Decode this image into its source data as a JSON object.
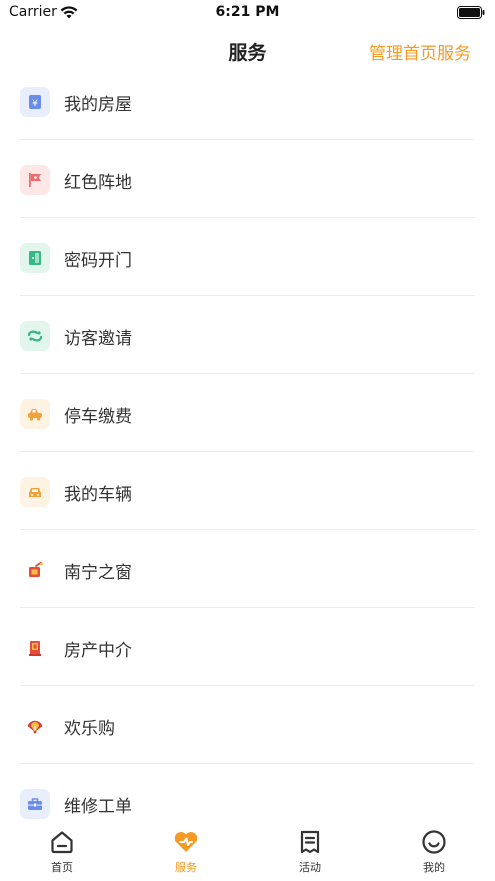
{
  "status_bar": {
    "carrier": "Carrier",
    "time": "6:21 PM"
  },
  "nav": {
    "title": "服务",
    "action": "管理首页服务"
  },
  "services": [
    {
      "label": "我的房屋",
      "icon": "house-yuan-icon",
      "bg": "#e8eefc",
      "fg": "#6b8de8"
    },
    {
      "label": "红色阵地",
      "icon": "red-flag-icon",
      "bg": "#fde7e7",
      "fg": "#ee6b6b"
    },
    {
      "label": "密码开门",
      "icon": "door-icon",
      "bg": "#e2f6ee",
      "fg": "#35b985"
    },
    {
      "label": "访客邀请",
      "icon": "visitor-icon",
      "bg": "#e2f6ee",
      "fg": "#35b985"
    },
    {
      "label": "停车缴费",
      "icon": "parking-icon",
      "bg": "#fff3e3",
      "fg": "#f5a23a"
    },
    {
      "label": "我的车辆",
      "icon": "car-icon",
      "bg": "#fff3e3",
      "fg": "#f5a23a"
    },
    {
      "label": "南宁之窗",
      "icon": "nanning-window-icon",
      "bg": "#ffffff",
      "fg": "#e84b3a"
    },
    {
      "label": "房产中介",
      "icon": "real-estate-icon",
      "bg": "#ffffff",
      "fg": "#e84b3a"
    },
    {
      "label": "欢乐购",
      "icon": "shopping-fan-icon",
      "bg": "#ffffff",
      "fg": "#d93a3a"
    },
    {
      "label": "维修工单",
      "icon": "toolbox-icon",
      "bg": "#e8eefc",
      "fg": "#6b8de8"
    }
  ],
  "tabs": [
    {
      "label": "首页",
      "icon": "home-icon",
      "active": false
    },
    {
      "label": "服务",
      "icon": "service-heart-icon",
      "active": true
    },
    {
      "label": "活动",
      "icon": "activity-list-icon",
      "active": false
    },
    {
      "label": "我的",
      "icon": "profile-smile-icon",
      "active": false
    }
  ],
  "colors": {
    "accent": "#f59a23",
    "text": "#333333",
    "divider": "#eeeeee"
  }
}
